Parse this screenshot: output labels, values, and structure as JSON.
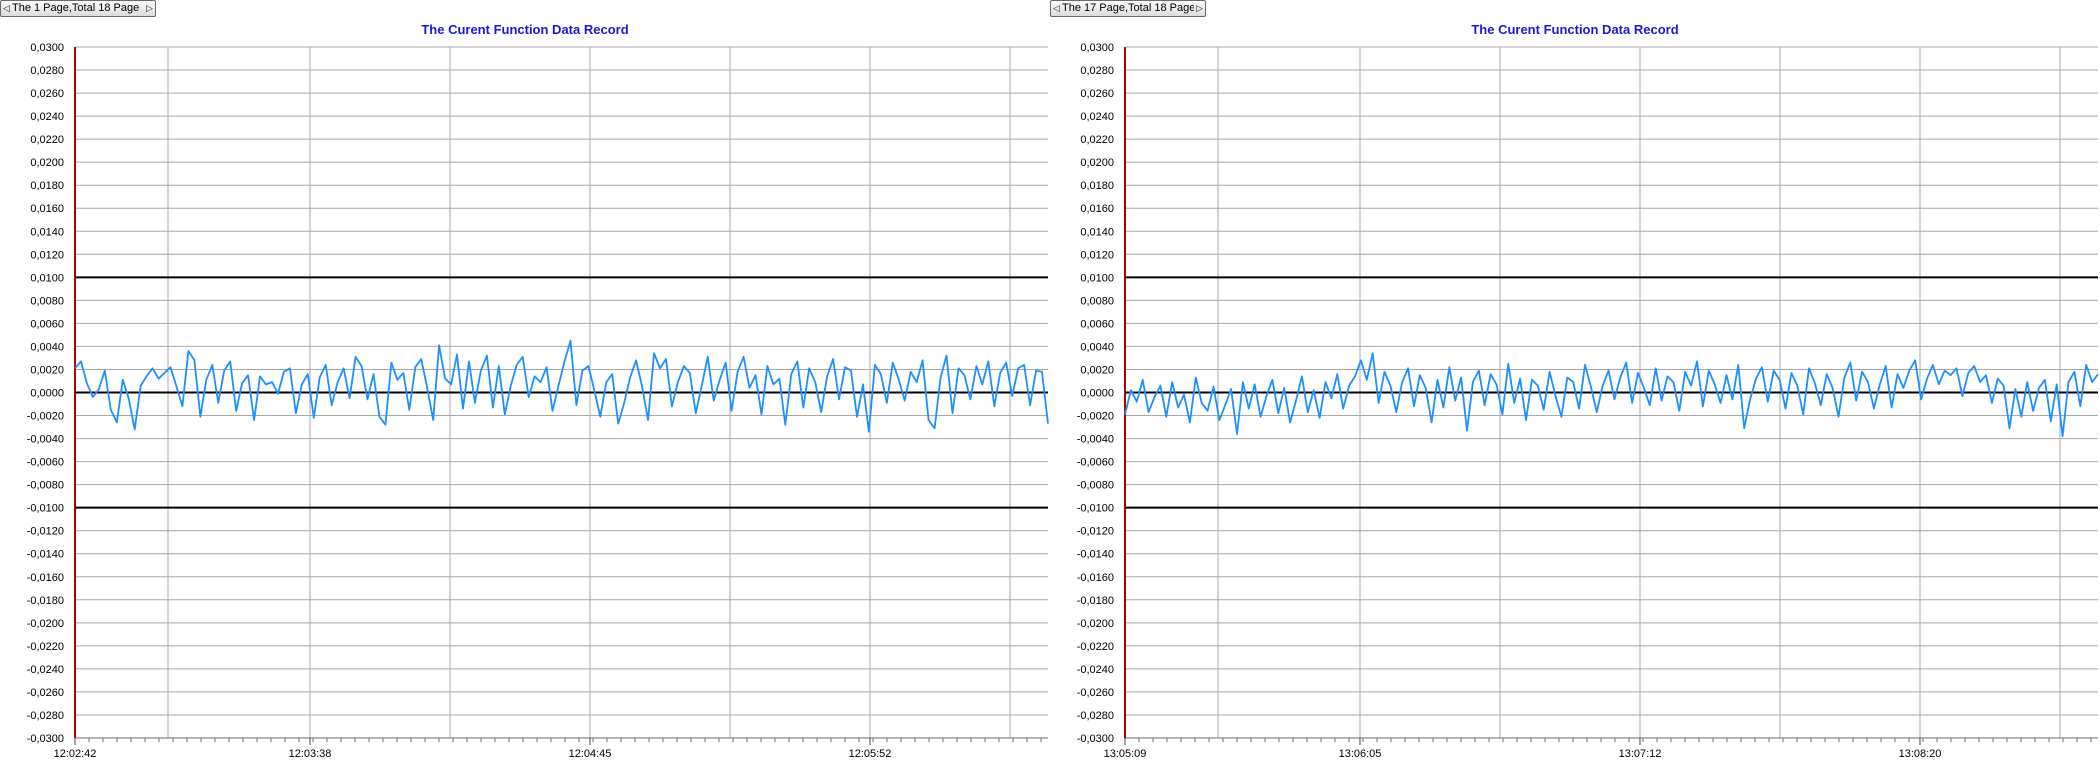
{
  "chart_data": [
    {
      "type": "line",
      "title": "The Curent Function Data Record",
      "pager_label": "The 1 Page,Total 18 Page",
      "y_ticks": [
        "0,0300",
        "0,0280",
        "0,0260",
        "0,0240",
        "0,0220",
        "0,0200",
        "0,0180",
        "0,0160",
        "0,0140",
        "0,0120",
        "0,0100",
        "0,0080",
        "0,0060",
        "0,0040",
        "0,0020",
        "0,0000",
        "-0,0020",
        "-0,0040",
        "-0,0060",
        "-0,0080",
        "-0,0100",
        "-0,0120",
        "-0,0140",
        "-0,0160",
        "-0,0180",
        "-0,0200",
        "-0,0220",
        "-0,0240",
        "-0,0260",
        "-0,0280",
        "-0,0300"
      ],
      "ylim": [
        -0.03,
        0.03
      ],
      "x_start": "12:02:42",
      "x_ticks": [
        "12:02:42",
        "12:03:38",
        "12:04:45",
        "12:05:52"
      ],
      "limits": [
        0.01,
        0.0,
        -0.01
      ],
      "line_color": "#1e8fff",
      "grid": true,
      "series": [
        {
          "values": [
            0.0021,
            0.0027,
            0.0008,
            -0.0004,
            0.0003,
            0.0019,
            -0.0015,
            -0.0026,
            0.0011,
            -0.0005,
            -0.0032,
            0.0006,
            0.0014,
            0.0021,
            0.0012,
            0.0017,
            0.0022,
            0.0005,
            -0.0012,
            0.0036,
            0.0028,
            -0.0021,
            0.0011,
            0.0024,
            -0.0009,
            0.0019,
            0.0027,
            -0.0016,
            0.0008,
            0.0015,
            -0.0024,
            0.0014,
            0.0007,
            0.0009,
            -0.0001,
            0.0018,
            0.0021,
            -0.0018,
            0.0007,
            0.0016,
            -0.0022,
            0.0013,
            0.0024,
            -0.0011,
            0.0009,
            0.0021,
            -0.0005,
            0.0031,
            0.0023,
            -0.0006,
            0.0016,
            -0.0021,
            -0.0028,
            0.0026,
            0.0011,
            0.0017,
            -0.0015,
            0.0022,
            0.0029,
            0.0004,
            -0.0024,
            0.0041,
            0.0012,
            0.0007,
            0.0033,
            -0.0014,
            0.0027,
            -0.0009,
            0.0019,
            0.0032,
            -0.0013,
            0.0023,
            -0.0019,
            0.0006,
            0.0024,
            0.0031,
            -0.0004,
            0.0014,
            0.0009,
            0.0022,
            -0.0016,
            0.0006,
            0.0027,
            0.0045,
            -0.0011,
            0.0019,
            0.0023,
            0.0002,
            -0.0021,
            0.0009,
            0.0016,
            -0.0027,
            -0.0009,
            0.0013,
            0.0028,
            0.0005,
            -0.0024,
            0.0034,
            0.0021,
            0.0029,
            -0.0012,
            0.0009,
            0.0023,
            0.0017,
            -0.0018,
            0.0006,
            0.0031,
            -0.0007,
            0.0011,
            0.0026,
            -0.0016,
            0.0018,
            0.0031,
            0.0004,
            0.0015,
            -0.0019,
            0.0023,
            0.0007,
            0.0012,
            -0.0028,
            0.0016,
            0.0027,
            -0.0013,
            0.0021,
            0.0009,
            -0.0017,
            0.0014,
            0.0029,
            -0.0006,
            0.0022,
            0.0019,
            -0.0021,
            0.0007,
            -0.0034,
            0.0024,
            0.0016,
            -0.0009,
            0.0026,
            0.0011,
            -0.0007,
            0.0018,
            0.0009,
            0.0028,
            -0.0024,
            -0.0031,
            0.0013,
            0.0032,
            -0.0018,
            0.0021,
            0.0015,
            -0.0006,
            0.0023,
            0.0007,
            0.0027,
            -0.0012,
            0.0017,
            0.0026,
            -0.0003,
            0.0021,
            0.0024,
            -0.0011,
            0.0019,
            0.0018,
            -0.0027
          ]
        }
      ]
    },
    {
      "type": "line",
      "title": "The Curent Function Data Record",
      "pager_label": "The 17 Page,Total 18 Page",
      "y_ticks": [
        "0,0300",
        "0,0280",
        "0,0260",
        "0,0240",
        "0,0220",
        "0,0200",
        "0,0180",
        "0,0160",
        "0,0140",
        "0,0120",
        "0,0100",
        "0,0080",
        "0,0060",
        "0,0040",
        "0,0020",
        "0,0000",
        "-0,0020",
        "-0,0040",
        "-0,0060",
        "-0,0080",
        "-0,0100",
        "-0,0120",
        "-0,0140",
        "-0,0160",
        "-0,0180",
        "-0,0200",
        "-0,0220",
        "-0,0240",
        "-0,0260",
        "-0,0280",
        "-0,0300"
      ],
      "ylim": [
        -0.03,
        0.03
      ],
      "x_start": "13:05:09",
      "x_ticks": [
        "13:05:09",
        "13:06:05",
        "13:07:12",
        "13:08:20"
      ],
      "limits": [
        0.01,
        0.0,
        -0.01
      ],
      "line_color": "#1e8fff",
      "grid": true,
      "series": [
        {
          "values": [
            -0.0019,
            0.0002,
            -0.0008,
            0.0011,
            -0.0017,
            -0.0004,
            0.0006,
            -0.0021,
            0.0009,
            -0.0013,
            -0.0002,
            -0.0026,
            0.0013,
            -0.0009,
            -0.0016,
            0.0005,
            -0.0024,
            -0.0011,
            0.0003,
            -0.0036,
            0.0009,
            -0.0014,
            0.0007,
            -0.0021,
            -0.0003,
            0.0011,
            -0.0018,
            0.0004,
            -0.0026,
            -0.0007,
            0.0014,
            -0.0017,
            0.0002,
            -0.0022,
            0.0009,
            -0.0005,
            0.0016,
            -0.0014,
            0.0006,
            0.0014,
            0.0028,
            0.0011,
            0.0034,
            -0.0009,
            0.0018,
            0.0006,
            -0.0017,
            0.0009,
            0.0021,
            -0.0012,
            0.0015,
            0.0004,
            -0.0026,
            0.0011,
            -0.0013,
            0.0022,
            -0.0007,
            0.0013,
            -0.0033,
            0.0009,
            0.0019,
            -0.0011,
            0.0016,
            0.0007,
            -0.0019,
            0.0025,
            -0.0009,
            0.0012,
            -0.0024,
            0.0011,
            0.0006,
            -0.0015,
            0.0018,
            -0.0003,
            -0.0021,
            0.0013,
            0.0009,
            -0.0014,
            0.0024,
            0.0005,
            -0.0017,
            0.0006,
            0.0019,
            -0.0006,
            0.0013,
            0.0026,
            -0.0009,
            0.0017,
            0.0004,
            -0.0011,
            0.0021,
            -0.0007,
            0.0014,
            0.0009,
            -0.0016,
            0.0018,
            0.0006,
            0.0027,
            -0.0012,
            0.0019,
            0.0007,
            -0.0009,
            0.0015,
            -0.0006,
            0.0024,
            -0.0031,
            -0.0006,
            0.0012,
            0.0022,
            -0.0008,
            0.0019,
            0.0011,
            -0.0014,
            0.0017,
            0.0006,
            -0.0019,
            0.0021,
            0.0008,
            -0.0011,
            0.0016,
            0.0004,
            -0.0021,
            0.0013,
            0.0026,
            -0.0007,
            0.0018,
            0.0009,
            -0.0014,
            0.0007,
            0.0023,
            -0.0013,
            0.0016,
            0.0004,
            0.0019,
            0.0028,
            -0.0006,
            0.0012,
            0.0024,
            0.0007,
            0.0019,
            0.0015,
            0.0021,
            -0.0003,
            0.0017,
            0.0023,
            0.0009,
            0.0015,
            -0.0009,
            0.0012,
            0.0006,
            -0.0031,
            0.0003,
            -0.0021,
            0.0009,
            -0.0016,
            0.0004,
            0.0011,
            -0.0025,
            0.0007,
            -0.0038,
            0.0009,
            0.0018,
            -0.0012,
            0.0024,
            0.0009,
            0.0016
          ]
        }
      ]
    }
  ]
}
